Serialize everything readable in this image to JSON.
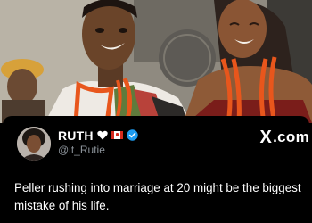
{
  "tweet": {
    "display_name": "RUTH",
    "handle": "@it_Rutie",
    "text": "Peller rushing into marriage at 20 might be the biggest mistake of his life.",
    "icons": [
      "heart-icon",
      "canada-flag-icon",
      "verified-icon"
    ]
  },
  "brand": {
    "logo_text": ".com",
    "logo_mark": "X"
  },
  "colors": {
    "background": "#000000",
    "text": "#ffffff",
    "handle": "#8b9299",
    "verified": "#1d9bf0",
    "beads": "#e8561c"
  }
}
